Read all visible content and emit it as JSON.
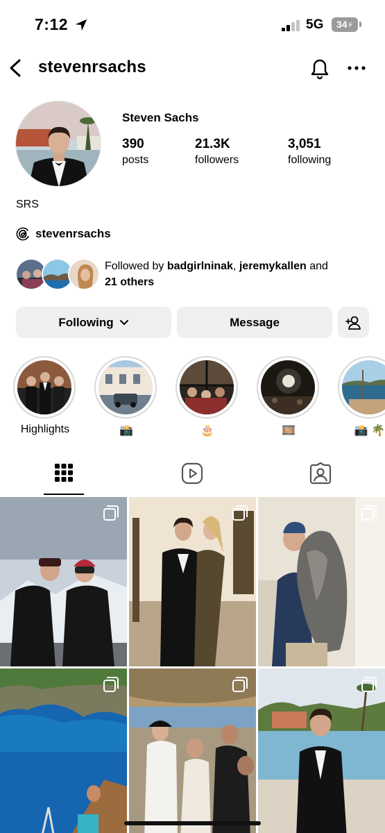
{
  "status_bar": {
    "time": "7:12",
    "network": "5G",
    "battery": "34"
  },
  "header": {
    "username": "stevenrsachs"
  },
  "profile": {
    "full_name": "Steven Sachs",
    "posts_count": "390",
    "posts_label": "posts",
    "followers_count": "21.3K",
    "followers_label": "followers",
    "following_count": "3,051",
    "following_label": "following",
    "bio": "SRS",
    "threads_handle": "stevenrsachs"
  },
  "followed_by": {
    "prefix": "Followed by ",
    "user1": "badgirlninak",
    "separator": ", ",
    "user2": "jeremykallen",
    "mid": " and",
    "others": "21 others"
  },
  "actions": {
    "following_label": "Following",
    "message_label": "Message"
  },
  "highlights": [
    {
      "label": "Highlights"
    },
    {
      "label": "📸"
    },
    {
      "label": "🎂"
    },
    {
      "label": "🎞️"
    },
    {
      "label": "📸 🌴"
    }
  ],
  "tabs": [
    "grid-icon",
    "reels-icon",
    "tagged-icon"
  ],
  "colors": {
    "button_bg": "#efefef",
    "battery_bg": "#9a9a9a",
    "ring": "#d8d8d8"
  }
}
